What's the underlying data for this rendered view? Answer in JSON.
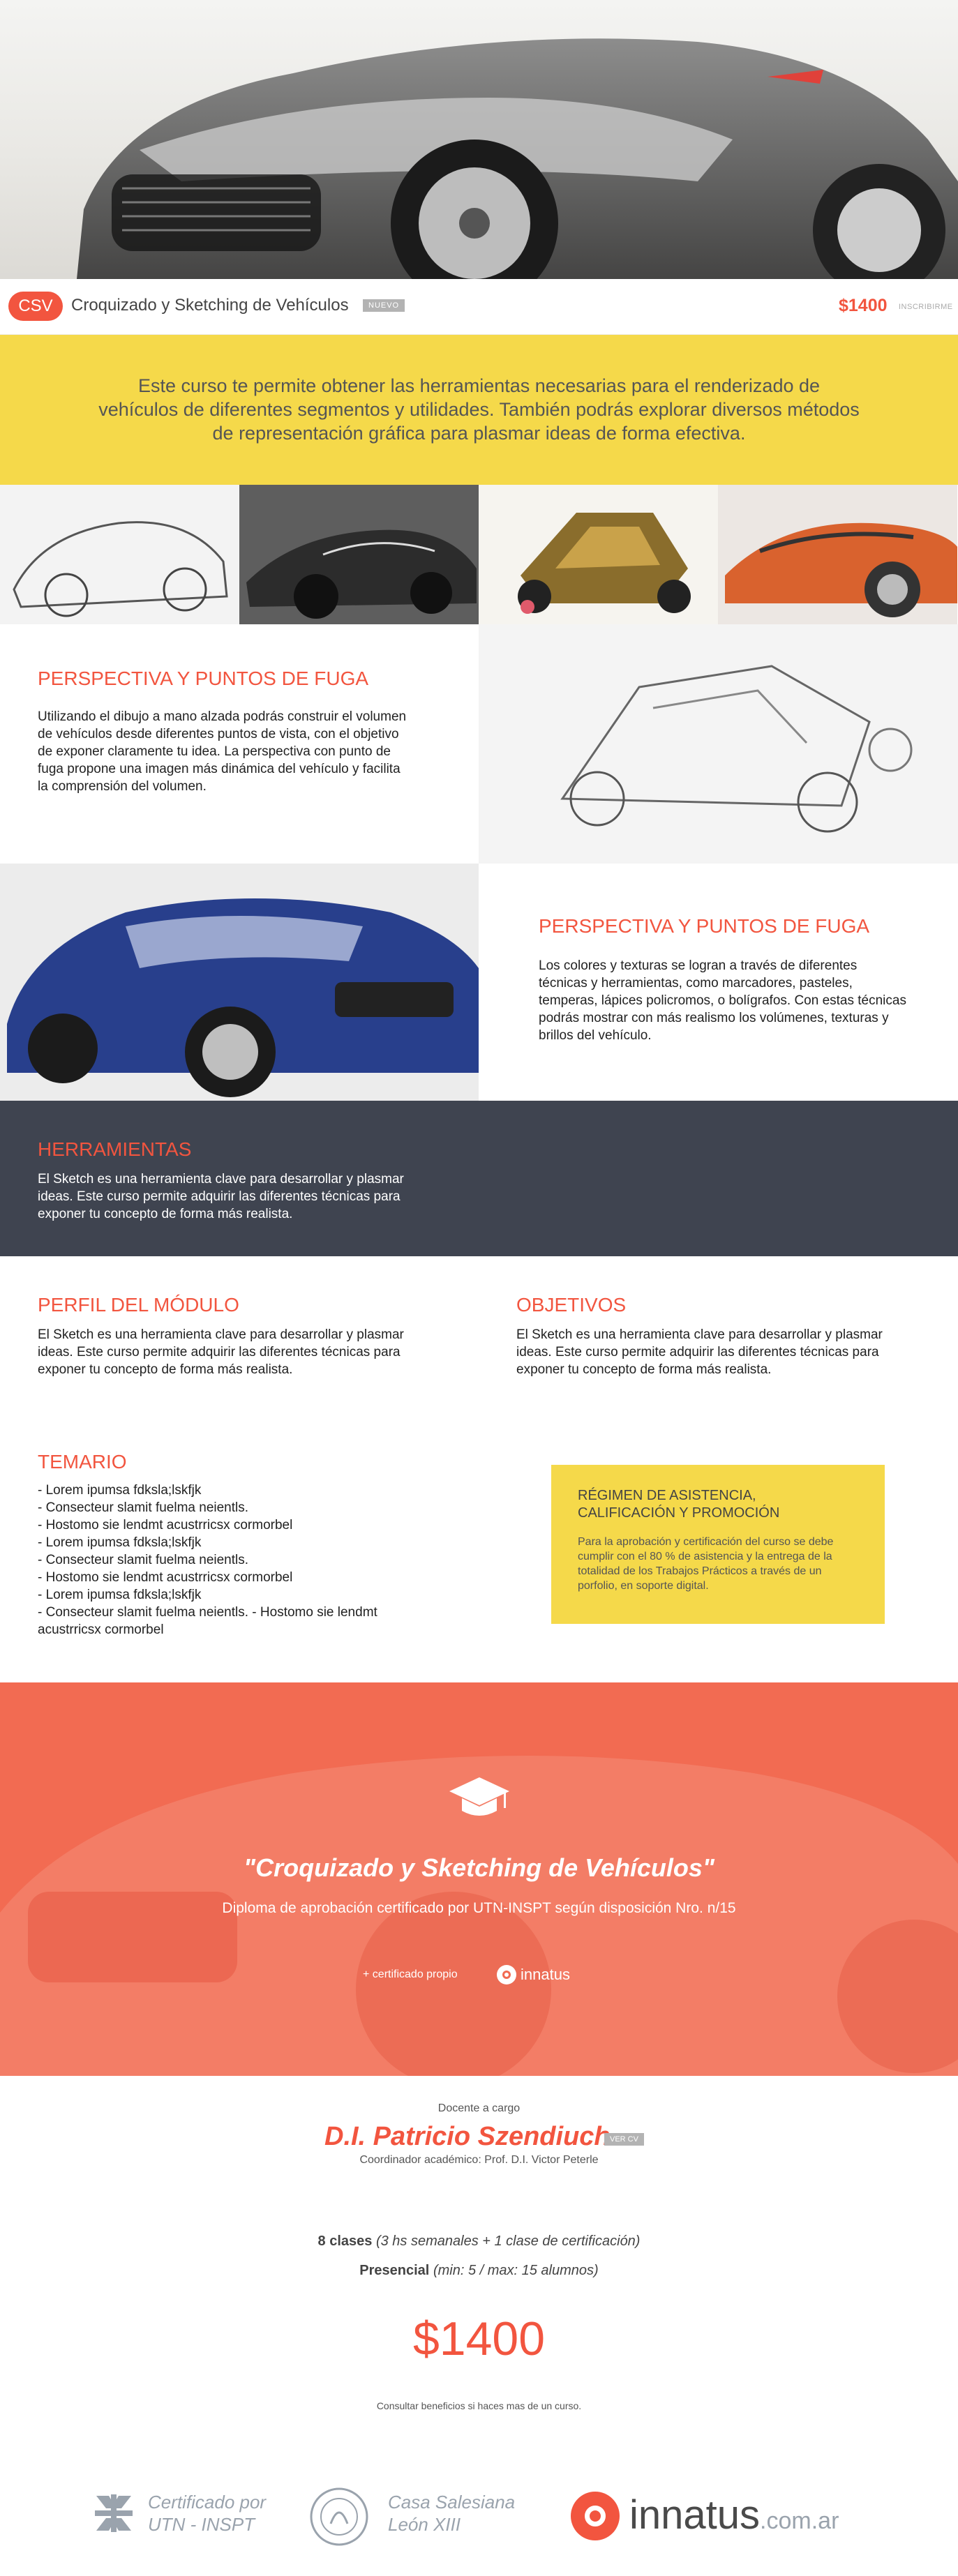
{
  "course_bar": {
    "badge": "CSV",
    "title": "Croquizado y Sketching de Vehículos",
    "tag": "NUEVO",
    "price": "$1400",
    "cta": "INSCRIBIRME"
  },
  "intro": {
    "text": "Este curso te permite obtener las herramientas necesarias para el renderizado de vehículos de diferentes segmentos y utilidades. También podrás explorar diversos métodos de representación gráfica para plasmar ideas de forma efectiva."
  },
  "section_perspectiva_1": {
    "title": "PERSPECTIVA Y PUNTOS DE FUGA",
    "text": "Utilizando el dibujo a mano alzada podrás construir el volumen de vehículos desde diferentes puntos de vista, con el objetivo de exponer claramente tu idea. La perspectiva con punto de fuga propone una imagen más dinámica del vehículo y facilita la comprensión del volumen."
  },
  "section_perspectiva_2": {
    "title": "PERSPECTIVA Y PUNTOS DE FUGA",
    "text": "Los colores y texturas se logran a través de diferentes técnicas y herramientas, como marcadores, pasteles, temperas, lápices policromos, o bolígrafos. Con estas técnicas podrás mostrar con más realismo los volúmenes, texturas y brillos del vehículo."
  },
  "herramientas": {
    "title": "HERRAMIENTAS",
    "text": "El Sketch es una herramienta clave para desarrollar y plasmar ideas. Este curso permite adquirir las diferentes técnicas para exponer tu concepto de forma más realista."
  },
  "perfil": {
    "title": "PERFIL DEL MÓDULO",
    "text": "El Sketch es una herramienta clave para desarrollar y plasmar ideas. Este curso permite adquirir las diferentes técnicas para exponer tu concepto de forma más realista."
  },
  "objetivos": {
    "title": "OBJETIVOS",
    "text": "El Sketch es una herramienta clave para desarrollar y plasmar ideas. Este curso permite adquirir las diferentes técnicas para exponer tu concepto de forma más realista."
  },
  "temario": {
    "title": "TEMARIO",
    "items": [
      "- Lorem ipumsa fdksla;lskfjk",
      "- Consecteur slamit fuelma neientls.",
      "- Hostomo sie lendmt acustrricsx cormorbel",
      "- Lorem ipumsa fdksla;lskfjk",
      "- Consecteur slamit fuelma neientls.",
      "- Hostomo sie lendmt acustrricsx cormorbel",
      "- Lorem ipumsa fdksla;lskfjk",
      "- Consecteur slamit fuelma neientls. - Hostomo sie lendmt",
      "acustrricsx cormorbel"
    ]
  },
  "regimen": {
    "title_line1": "RÉGIMEN DE ASISTENCIA,",
    "title_line2": "CALIFICACIÓN Y PROMOCIÓN",
    "text": "Para la aprobación y certificación del curso se debe cumplir con el 80 % de asistencia y la entrega de la totalidad de los Trabajos Prácticos a través de un porfolio, en soporte digital."
  },
  "diploma": {
    "title": "\"Croquizado y Sketching de Vehículos\"",
    "subtitle": "Diploma de aprobación certificado por UTN-INSPT según disposición Nro. n/15",
    "cert_text": "+ certificado propio",
    "cert_brand": "innatus"
  },
  "docente": {
    "label": "Docente a cargo",
    "name": "D.I. Patricio Szendiuch",
    "cv": "VER CV",
    "coordinator": "Coordinador académico: Prof. D.I. Victor Peterle"
  },
  "info": {
    "classes_bold": "8 clases",
    "classes_italic": "(3 hs semanales + 1 clase de certificación)",
    "mode_bold": "Presencial",
    "mode_italic": "(min: 5 / max: 15 alumnos)",
    "price": "$1400",
    "note": "Consultar beneficios si haces mas de un curso."
  },
  "logos": {
    "utn_line1": "Certificado por",
    "utn_line2": "UTN - INSPT",
    "casa_line1": "Casa Salesiana",
    "casa_line2": "León XIII",
    "innatus_name": "innatus",
    "innatus_domain": ".com.ar"
  },
  "colors": {
    "accent": "#f2553f",
    "yellow": "#f5d94a",
    "dark": "#3f4450",
    "diploma_bg": "#f26b52"
  }
}
